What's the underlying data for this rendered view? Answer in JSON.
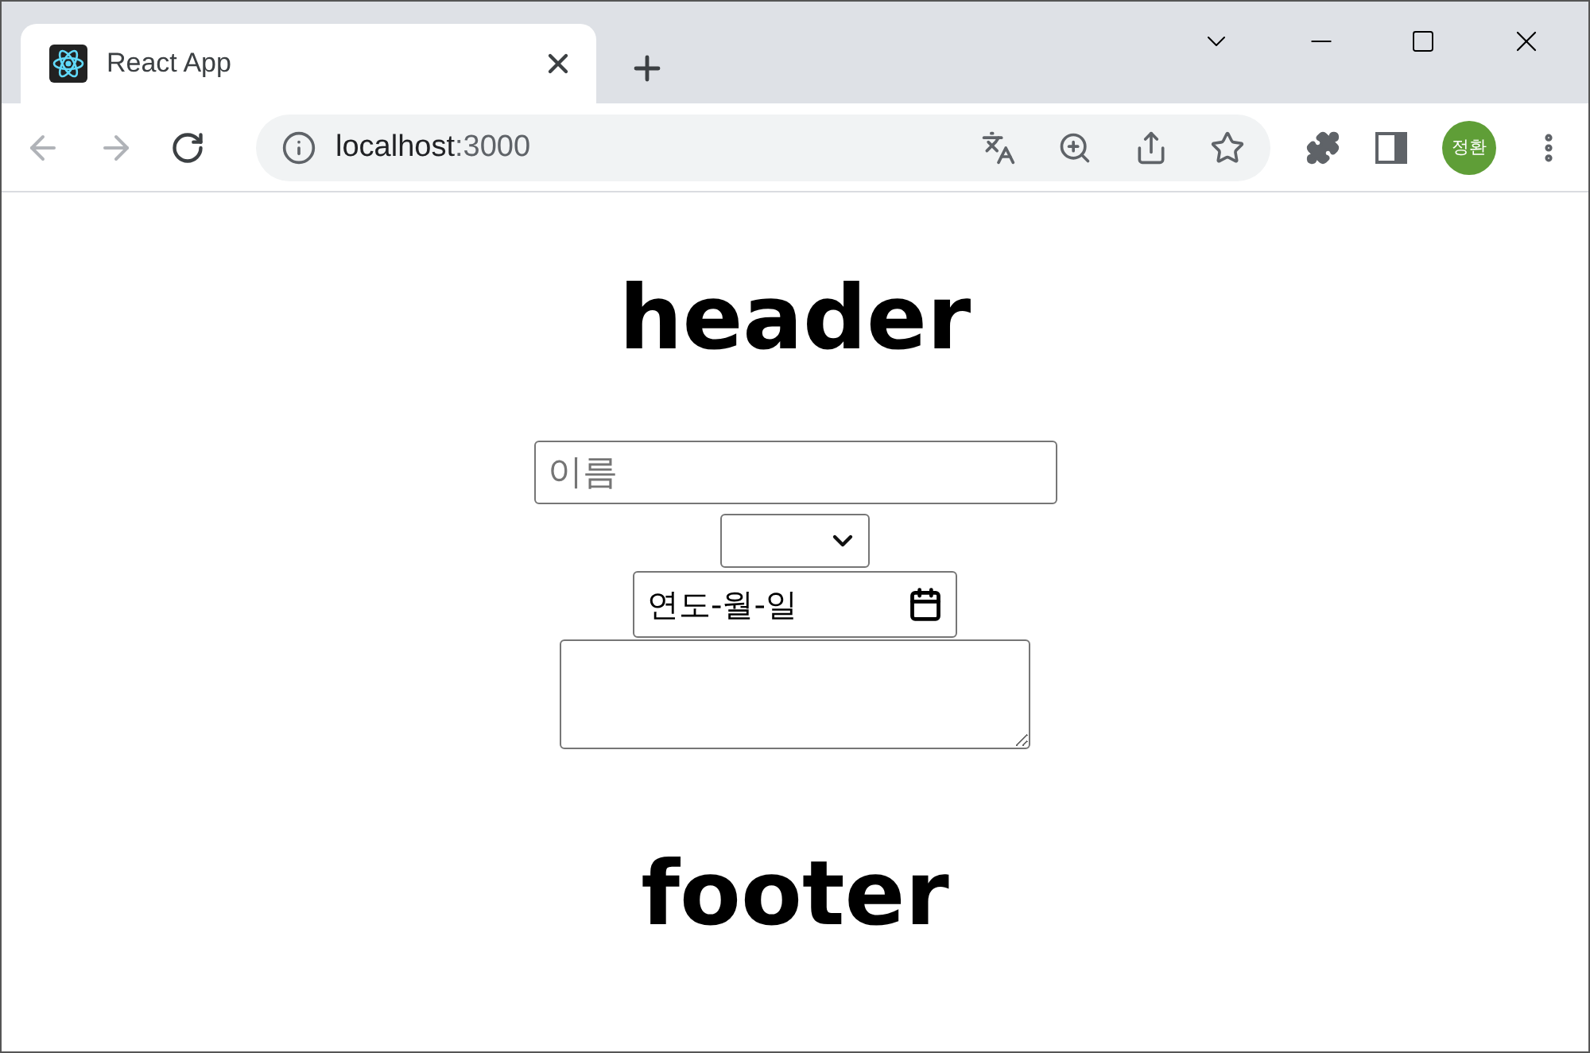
{
  "browser": {
    "tab": {
      "title": "React App",
      "selected": true
    },
    "address": {
      "host": "localhost",
      "port": ":3000"
    },
    "profile": {
      "initials": "정환"
    }
  },
  "page": {
    "header": "header",
    "name_field": {
      "placeholder": "이름"
    },
    "date_field": {
      "placeholder": "연도-월-일"
    },
    "footer": "footer"
  }
}
